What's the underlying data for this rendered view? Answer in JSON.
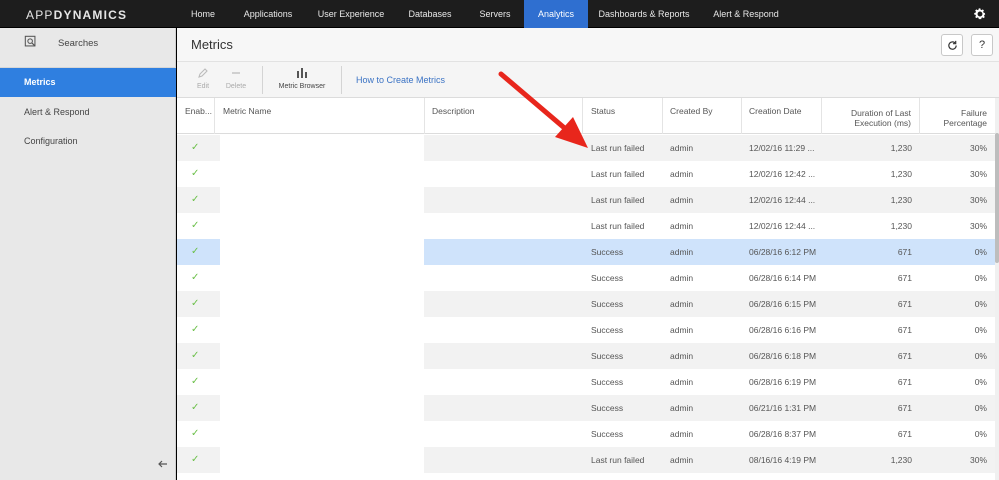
{
  "brand": {
    "light": "APP",
    "bold": "DYNAMICS"
  },
  "nav": {
    "items": [
      {
        "label": "Home"
      },
      {
        "label": "Applications"
      },
      {
        "label": "User Experience"
      },
      {
        "label": "Databases"
      },
      {
        "label": "Servers"
      },
      {
        "label": "Analytics",
        "active": true
      },
      {
        "label": "Dashboards & Reports"
      },
      {
        "label": "Alert & Respond"
      }
    ],
    "settings_icon": "gear-icon"
  },
  "sidebar": {
    "search_label": "Searches",
    "items": [
      {
        "label": "Metrics",
        "active": true
      },
      {
        "label": "Alert & Respond"
      },
      {
        "label": "Configuration"
      }
    ]
  },
  "page": {
    "title": "Metrics",
    "refresh_icon": "refresh-icon",
    "help_label": "?"
  },
  "toolbar": {
    "edit_label": "Edit",
    "delete_label": "Delete",
    "browser_label": "Metric Browser",
    "howto_label": "How to Create Metrics"
  },
  "table": {
    "columns": {
      "enabled": "Enab...",
      "name": "Metric Name",
      "description": "Description",
      "status": "Status",
      "created_by": "Created By",
      "creation_date": "Creation Date",
      "duration_1": "Duration of Last",
      "duration_2": "Execution (ms)",
      "failure_1": "Failure",
      "failure_2": "Percentage"
    },
    "rows": [
      {
        "status": "Last run failed",
        "created_by": "admin",
        "date": "12/02/16 11:29 ...",
        "duration": "1,230",
        "failure": "30%"
      },
      {
        "status": "Last run failed",
        "created_by": "admin",
        "date": "12/02/16 12:42 ...",
        "duration": "1,230",
        "failure": "30%"
      },
      {
        "status": "Last run failed",
        "created_by": "admin",
        "date": "12/02/16 12:44 ...",
        "duration": "1,230",
        "failure": "30%"
      },
      {
        "status": "Last run failed",
        "created_by": "admin",
        "date": "12/02/16 12:44 ...",
        "duration": "1,230",
        "failure": "30%"
      },
      {
        "status": "Success",
        "created_by": "admin",
        "date": "06/28/16 6:12 PM",
        "duration": "671",
        "failure": "0%",
        "selected": true
      },
      {
        "status": "Success",
        "created_by": "admin",
        "date": "06/28/16 6:14 PM",
        "duration": "671",
        "failure": "0%"
      },
      {
        "status": "Success",
        "created_by": "admin",
        "date": "06/28/16 6:15 PM",
        "duration": "671",
        "failure": "0%"
      },
      {
        "status": "Success",
        "created_by": "admin",
        "date": "06/28/16 6:16 PM",
        "duration": "671",
        "failure": "0%"
      },
      {
        "status": "Success",
        "created_by": "admin",
        "date": "06/28/16 6:18 PM",
        "duration": "671",
        "failure": "0%"
      },
      {
        "status": "Success",
        "created_by": "admin",
        "date": "06/28/16 6:19 PM",
        "duration": "671",
        "failure": "0%"
      },
      {
        "status": "Success",
        "created_by": "admin",
        "date": "06/21/16 1:31 PM",
        "duration": "671",
        "failure": "0%"
      },
      {
        "status": "Success",
        "created_by": "admin",
        "date": "06/28/16 8:37 PM",
        "duration": "671",
        "failure": "0%"
      },
      {
        "status": "Last run failed",
        "created_by": "admin",
        "date": "08/16/16 4:19 PM",
        "duration": "1,230",
        "failure": "30%"
      }
    ],
    "enabled_mark": "✓"
  },
  "colors": {
    "active_nav": "#2f6fd0",
    "active_sidebar": "#2f7fe0",
    "link": "#3b73c4",
    "check": "#6cc04a",
    "annotation_arrow": "#e8261c"
  }
}
